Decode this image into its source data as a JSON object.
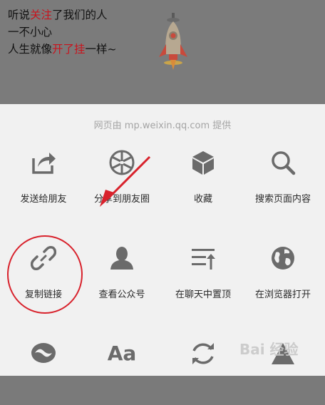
{
  "banner": {
    "line1_pre": "听说",
    "line1_hl": "关注",
    "line1_post": "了我们的人",
    "line2": "一不小心",
    "line3_pre": "人生就像",
    "line3_hl": "开了挂",
    "line3_post": "一样~"
  },
  "provider_text": "网页由 mp.weixin.qq.com 提供",
  "menu": {
    "row1": [
      {
        "label": "发送给朋友",
        "icon": "share-arrow-icon"
      },
      {
        "label": "分享到朋友圈",
        "icon": "moments-aperture-icon"
      },
      {
        "label": "收藏",
        "icon": "cube-icon"
      },
      {
        "label": "搜索页面内容",
        "icon": "search-icon"
      }
    ],
    "row2": [
      {
        "label": "复制链接",
        "icon": "link-icon"
      },
      {
        "label": "查看公众号",
        "icon": "person-icon"
      },
      {
        "label": "在聊天中置顶",
        "icon": "pin-top-icon"
      },
      {
        "label": "在浏览器打开",
        "icon": "globe-icon"
      }
    ],
    "row3": [
      {
        "label": "",
        "icon": "eye-bubble-icon"
      },
      {
        "label": "Aa",
        "icon": "font-size-icon"
      },
      {
        "label": "",
        "icon": "refresh-icon"
      },
      {
        "label": "",
        "icon": "warning-icon"
      }
    ]
  },
  "colors": {
    "accent_red": "#c8141e",
    "icon_gray": "#6b6b6b",
    "sheet_bg": "#f1f1f1"
  },
  "watermark": "Bai 经验"
}
